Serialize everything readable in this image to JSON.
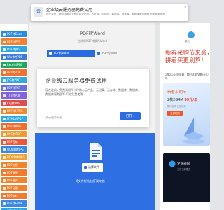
{
  "notification": {
    "icon_label": "云",
    "title": "企业级云服务器免费试用",
    "description": "现在注册，免费试用几十种核心云产品，云计算、云存储、数据库、数据库、数据库服务器等 开始免费使用",
    "close": "✕"
  },
  "sidebar": {
    "items": [
      {
        "label": "PDF转Excel",
        "color": "#2a8be2"
      },
      {
        "label": "PDF转PPT",
        "color": "#f08231"
      },
      {
        "label": "PDF转JPG",
        "color": "#2ea7e0"
      },
      {
        "label": "Word转PDF",
        "color": "#3f7bdb"
      },
      {
        "label": "Excel转PDF",
        "color": "#1fa761"
      },
      {
        "label": "PPT转PDF",
        "color": "#f0712f"
      },
      {
        "label": "JPG转PDF",
        "color": "#34a9df"
      },
      {
        "label": "PDF转TXT",
        "color": "#6a6fe0"
      },
      {
        "label": "TXT转PDF",
        "color": "#8162df"
      },
      {
        "label": "CAJ转PDF",
        "color": "#df4d4d"
      },
      {
        "label": "PDF转HTML",
        "color": "#ef8833"
      },
      {
        "label": "HTML转PDF",
        "color": "#2fa7e1"
      },
      {
        "label": "PDF转PNG",
        "color": "#f06e2e"
      },
      {
        "label": "PNG转PDF",
        "color": "#f09a2f"
      },
      {
        "label": "PDF压缩",
        "color": "#ee5838"
      },
      {
        "label": "WORD转JPG",
        "color": "#3c86e5"
      },
      {
        "label": "WORD转PNG",
        "color": "#f0a030"
      },
      {
        "label": "PDF加密",
        "color": "#f08530"
      },
      {
        "label": "PDF解密",
        "color": "#f07a2f"
      },
      {
        "label": "PDF合并",
        "color": "#f0842f"
      },
      {
        "label": "PDF分割",
        "color": "#f0812f"
      },
      {
        "label": "PDF旋转",
        "color": "#f07a30"
      },
      {
        "label": "PDF转EPUB",
        "color": "#3a8ae3"
      },
      {
        "label": "WORD转图片",
        "color": "#2ea3e1"
      }
    ]
  },
  "main": {
    "title": "PDF转Word",
    "subtitle": "在线将PDF转换为Word",
    "tabs": [
      {
        "label": "PDF转Word"
      },
      {
        "label": "PDF转Word"
      }
    ],
    "ad": {
      "title": "企业级云服务器免费试用",
      "description": "现在注册，免费试用几十种核心云产品，云计算、云存储、数据库、数据库、数据库服务器等 开始免费使用",
      "link": "某云服务平台",
      "open_label": "打开 ›"
    },
    "upload": {
      "button_label": "选择文件",
      "hint": "将文件拖到此处开始转换"
    }
  },
  "right": {
    "logo_text": "某云",
    "headline": "新春采购节来袭，拼着买更划算！",
    "sub": "2核2G4M服务器，限时特惠仅需99元/年",
    "promo": {
      "title": "新春采购节",
      "price_prefix": "2核2G4M ",
      "price": "99元/年",
      "note": "限时秒杀 立即抢购",
      "button": "立即抢购"
    },
    "dark_card": {
      "title": "企业采购",
      "sub": "立即了解更多"
    }
  }
}
